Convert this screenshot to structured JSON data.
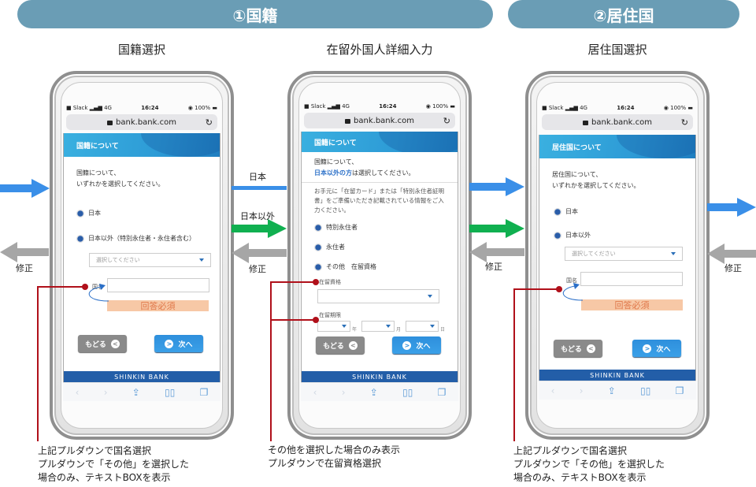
{
  "banners": {
    "section1": "①国籍",
    "section2": "②居住国"
  },
  "screens": [
    {
      "title": "国籍選択",
      "status": {
        "carrier": "Slack",
        "network": "4G",
        "time": "16:24",
        "battery": "100%"
      },
      "url": "bank.bank.com",
      "header": "国籍について",
      "intro_line1": "国籍について、",
      "intro_line2": "いずれかを選択してください。",
      "options": [
        "日本",
        "日本以外（特別永住者・永住者含む）"
      ],
      "select_placeholder": "選択してください",
      "country_label": "国名",
      "required_label": "回答必須",
      "back_label": "もどる",
      "next_label": "次へ",
      "footer": "SHINKIN  BANK"
    },
    {
      "title": "在留外国人詳細入力",
      "status": {
        "carrier": "Slack",
        "network": "4G",
        "time": "16:24",
        "battery": "100%"
      },
      "url": "bank.bank.com",
      "header": "国籍について",
      "intro_line1": "国籍について、",
      "intro_highlight": "日本以外の方",
      "intro_line2_rest": "は選択してください。",
      "notice": "お手元に「在留カード」または「特別永住者証明書」をご準備いただき記載されている情報をご入力ください。",
      "options": [
        "特別永住者",
        "永住者",
        "その他　在留資格"
      ],
      "status_label": "在留資格",
      "period_label": "在留期限",
      "date_units": [
        "年",
        "月",
        "日"
      ],
      "back_label": "もどる",
      "next_label": "次へ",
      "footer": "SHINKIN  BANK"
    },
    {
      "title": "居住国選択",
      "status": {
        "carrier": "Slack",
        "network": "4G",
        "time": "16:24",
        "battery": "100%"
      },
      "url": "bank.bank.com",
      "header": "居住国について",
      "intro_line1": "居住国について、",
      "intro_line2": "いずれかを選択してください。",
      "options": [
        "日本",
        "日本以外"
      ],
      "select_placeholder": "選択してください",
      "country_label": "国名",
      "required_label": "回答必須",
      "back_label": "もどる",
      "next_label": "次へ",
      "footer": "SHINKIN  BANK"
    }
  ],
  "flow_labels": {
    "japan": "日本",
    "non_japan": "日本以外",
    "fix": "修正"
  },
  "notes": {
    "left": [
      "上記プルダウンで国名選択",
      "プルダウンで「その他」を選択した",
      "場合のみ、テキストBOXを表示"
    ],
    "middle": [
      "その他を選択した場合のみ表示",
      "プルダウンで在留資格選択"
    ],
    "right": [
      "上記プルダウンで国名選択",
      "プルダウンで「その他」を選択した",
      "場合のみ、テキストBOXを表示"
    ]
  },
  "colors": {
    "banner": "#6a9db5",
    "arrow_blue": "#3a8fe8",
    "arrow_green": "#10b050",
    "arrow_gray": "#a6a6a6",
    "annotation_red": "#b0101a",
    "required_bg": "#f7c8a6",
    "footer_blue": "#235ea8"
  }
}
